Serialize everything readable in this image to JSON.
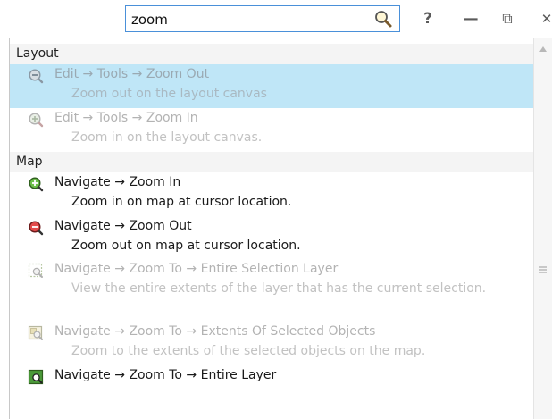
{
  "search": {
    "value": "zoom"
  },
  "window_controls": {
    "help": "?",
    "minimize": "—",
    "restore": "⧉",
    "close": "✕"
  },
  "groups": [
    {
      "header": "Layout",
      "items": [
        {
          "title": "Edit → Tools → Zoom Out",
          "desc": "Zoom out on the layout canvas",
          "state": "selected-disabled",
          "icon": "zoom-out-icon"
        },
        {
          "title": "Edit → Tools → Zoom In",
          "desc": "Zoom in on the layout canvas.",
          "state": "disabled",
          "icon": "zoom-in-icon"
        }
      ]
    },
    {
      "header": "Map",
      "items": [
        {
          "title": "Navigate → Zoom In",
          "desc": "Zoom in on map at cursor location.",
          "state": "enabled",
          "icon": "zoom-in-icon"
        },
        {
          "title": "Navigate → Zoom Out",
          "desc": "Zoom out on map at cursor location.",
          "state": "enabled",
          "icon": "zoom-out-icon"
        },
        {
          "title": "Navigate → Zoom To → Entire Selection Layer",
          "desc": "View the entire extents of the layer that has the current selection.",
          "state": "disabled",
          "icon": "zoom-selection-layer-icon"
        },
        {
          "title": "Navigate → Zoom To → Extents Of Selected Objects",
          "desc": "Zoom to the extents of the selected objects on the map.",
          "state": "disabled",
          "icon": "zoom-selected-objects-icon"
        },
        {
          "title": "Navigate → Zoom To → Entire Layer",
          "desc": "",
          "state": "enabled",
          "icon": "zoom-entire-layer-icon"
        }
      ]
    }
  ],
  "colors": {
    "selection": "#bfe6f7",
    "accent": "#4a90d9",
    "group_header_bg": "#f4f4f4",
    "disabled_text": "#b3b3b3"
  }
}
